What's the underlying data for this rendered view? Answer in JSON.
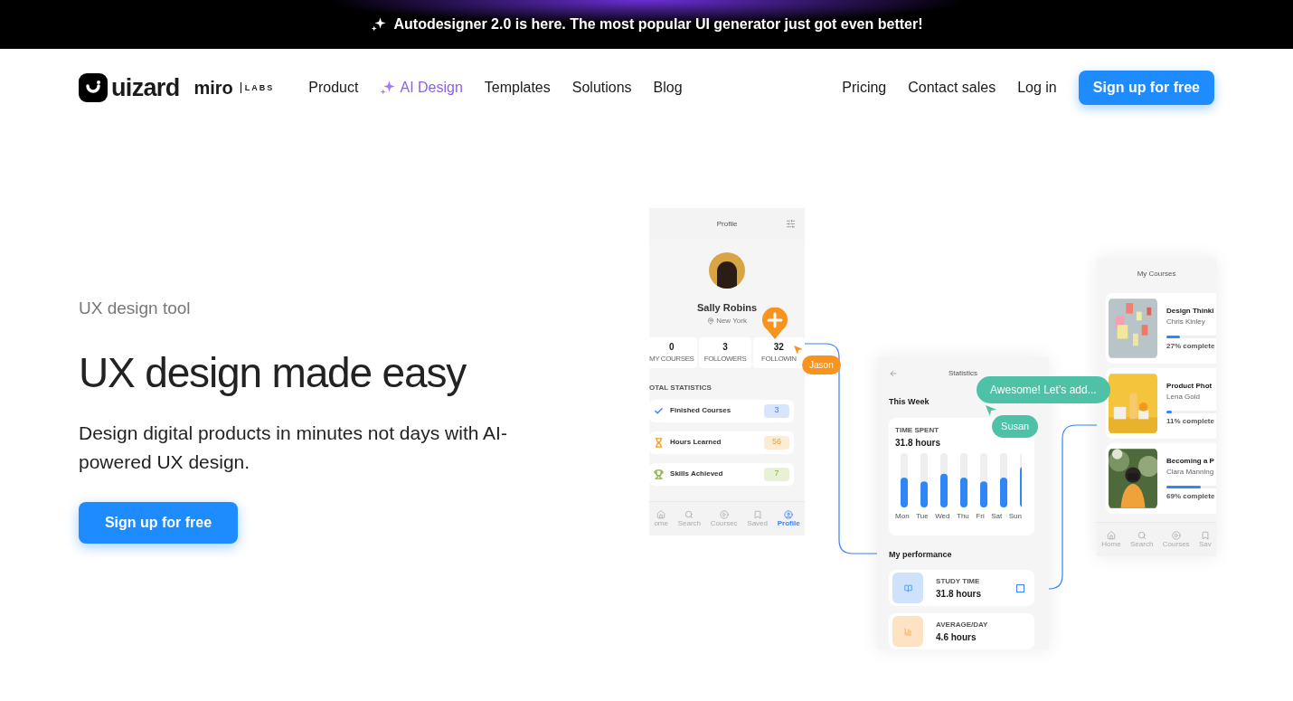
{
  "announcement": {
    "text": "Autodesigner 2.0 is here. The most popular UI generator just got even better!"
  },
  "nav": {
    "logo": "uizard",
    "partner": "miro",
    "partner_suffix": "LABS",
    "links": [
      {
        "label": "Product",
        "kind": "plain"
      },
      {
        "label": "AI Design",
        "kind": "ai"
      },
      {
        "label": "Templates",
        "kind": "plain"
      },
      {
        "label": "Solutions",
        "kind": "plain"
      },
      {
        "label": "Blog",
        "kind": "plain"
      }
    ],
    "right_links": [
      "Pricing",
      "Contact sales",
      "Log in"
    ],
    "cta": "Sign up for free"
  },
  "hero": {
    "eyebrow": "UX design tool",
    "title": "UX design made easy",
    "subtitle": "Design digital products in minutes not days with AI-powered UX design.",
    "cta": "Sign up for free"
  },
  "profile_screen": {
    "title": "Profile",
    "name": "Sally Robins",
    "location": "New York",
    "stats": [
      {
        "value": "0",
        "label": "MY COURSES"
      },
      {
        "value": "3",
        "label": "FOLLOWERS"
      },
      {
        "value": "32",
        "label": "FOLLOWIN"
      }
    ],
    "section": "OTAL STATISTICS",
    "rows": [
      {
        "kind": "check",
        "label": "Finished Courses",
        "value": "3",
        "color": "#3b82f6"
      },
      {
        "kind": "hourglass",
        "label": "Hours Learned",
        "value": "56",
        "color": "#f0a030"
      },
      {
        "kind": "trophy",
        "label": "Skills Achieved",
        "value": "7",
        "color": "#8cb43c"
      }
    ],
    "tabs": [
      {
        "kind": "home",
        "label": "ome",
        "selected": false
      },
      {
        "kind": "search",
        "label": "Search",
        "selected": false
      },
      {
        "kind": "play",
        "label": "Coursec",
        "selected": false
      },
      {
        "kind": "bookmark",
        "label": "Saved",
        "selected": false
      },
      {
        "kind": "user",
        "label": "Profile",
        "selected": true
      }
    ]
  },
  "stats_screen": {
    "title": "Statistics",
    "week": "This Week",
    "card_label": "TIME SPENT",
    "card_value": "31.8 hours",
    "days": [
      "Mon",
      "Tue",
      "Wed",
      "Thu",
      "Fri",
      "Sat",
      "Sun"
    ],
    "performance": "My performance",
    "rows": [
      {
        "kind": "book",
        "label": "STUDY TIME",
        "value": "31.8 hours"
      },
      {
        "kind": "chart",
        "label": "AVERAGE/DAY",
        "value": "4.6 hours"
      }
    ]
  },
  "courses_screen": {
    "title": "My Courses",
    "courses": [
      {
        "title": "Design Thinki",
        "author": "Chris Kinley",
        "progress": "27% complete",
        "level": 0.27
      },
      {
        "title": "Product Phot",
        "author": "Lena Gold",
        "progress": "11% complete",
        "level": 0.11
      },
      {
        "title": "Becoming a P",
        "author": "Clara Manning",
        "progress": "69% complete",
        "level": 0.69
      }
    ],
    "tabs": [
      {
        "kind": "home",
        "label": "Home",
        "selected": false
      },
      {
        "kind": "search",
        "label": "Search",
        "selected": false
      },
      {
        "kind": "play",
        "label": "Courses",
        "selected": false
      },
      {
        "kind": "bookmark",
        "label": "Sav",
        "selected": false
      }
    ]
  },
  "collaborators": [
    {
      "name": "Jason",
      "color": "#f7931e"
    },
    {
      "name": "Susan",
      "color": "#4fc1a6",
      "message": "Awesome! Let’s add..."
    }
  ]
}
